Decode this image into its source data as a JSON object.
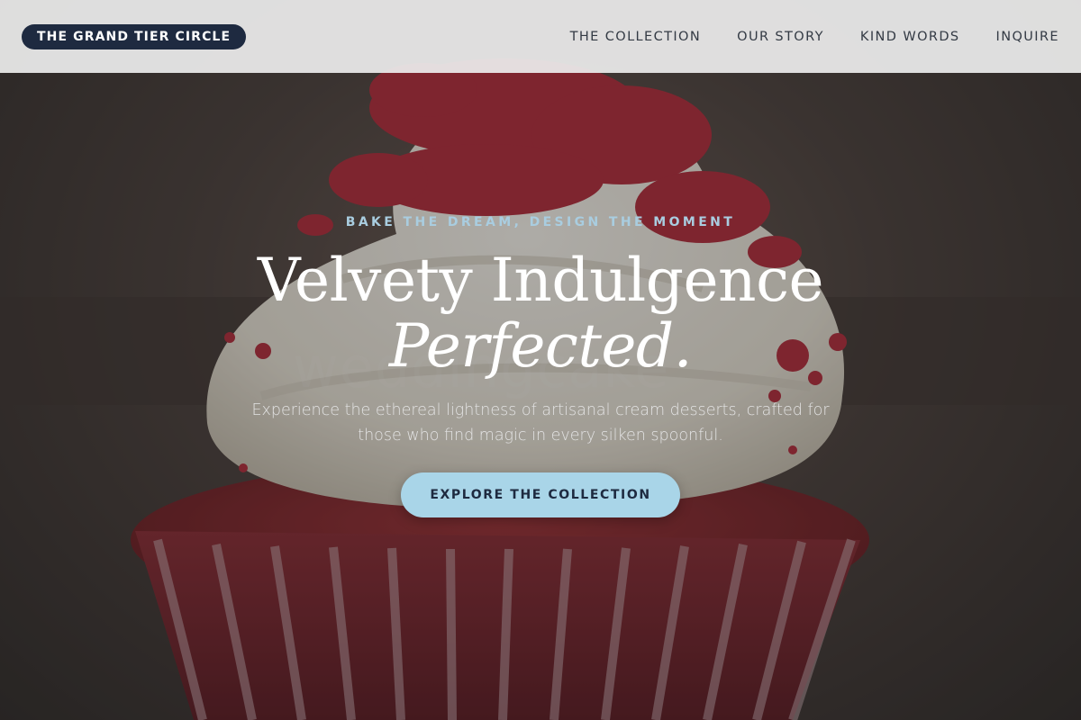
{
  "brand": {
    "label": "THE GRAND TIER CIRCLE"
  },
  "nav": {
    "items": [
      {
        "label": "THE COLLECTION"
      },
      {
        "label": "OUR STORY"
      },
      {
        "label": "KIND WORDS"
      },
      {
        "label": "INQUIRE"
      }
    ]
  },
  "hero": {
    "eyebrow": "BAKE THE DREAM, DESIGN THE MOMENT",
    "headline_line1": "Velvety Indulgence",
    "headline_line2": "Perfected.",
    "subtext": "Experience the ethereal lightness of artisanal cream desserts, crafted for those who find magic in every silken spoonful.",
    "cta_label": "EXPLORE THE COLLECTION",
    "watermark": "weddingcake"
  },
  "colors": {
    "navbar_bg": "#ececec",
    "brand_bg": "#1e2a40",
    "accent": "#a9d5e8",
    "eyebrow": "#a9cde0",
    "cake_red": "#8c2a30",
    "frosting": "#f3efe6"
  }
}
